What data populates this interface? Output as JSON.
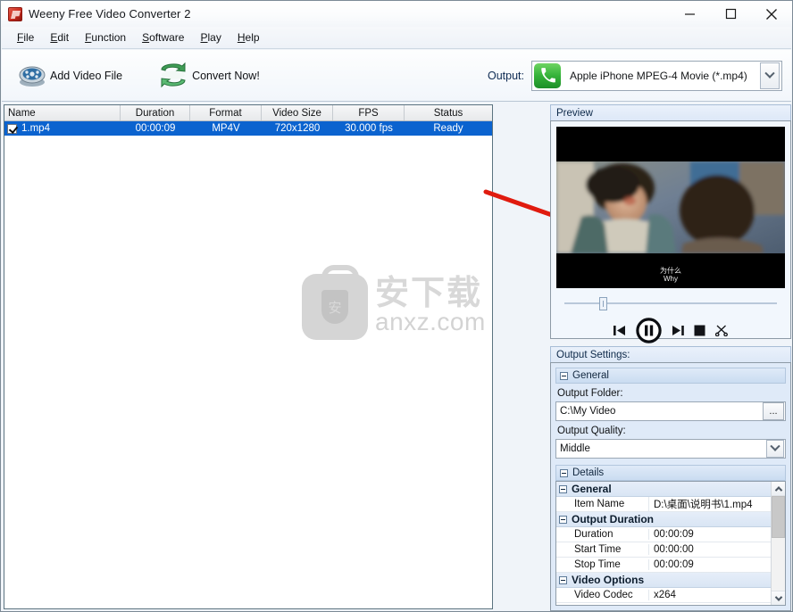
{
  "window": {
    "title": "Weeny Free Video Converter 2",
    "app_icon": "app-icon",
    "minimize": "–",
    "maximize": "□",
    "close": "✕"
  },
  "menubar": {
    "items": [
      {
        "label": "File",
        "accel": "F",
        "rest": "ile"
      },
      {
        "label": "Edit",
        "accel": "E",
        "rest": "dit"
      },
      {
        "label": "Function",
        "accel": "F",
        "rest": "unction"
      },
      {
        "label": "Software",
        "accel": "S",
        "rest": "oftware"
      },
      {
        "label": "Play",
        "accel": "P",
        "rest": "lay"
      },
      {
        "label": "Help",
        "accel": "H",
        "rest": "elp"
      }
    ]
  },
  "toolbar": {
    "add_video_label": "Add Video File",
    "convert_label": "Convert Now!",
    "output_label": "Output:",
    "output_value": "Apple iPhone MPEG-4 Movie (*.mp4)"
  },
  "filelist": {
    "columns": [
      "Name",
      "Duration",
      "Format",
      "Video Size",
      "FPS",
      "Status"
    ],
    "rows": [
      {
        "checked": true,
        "name": "1.mp4",
        "duration": "00:00:09",
        "format": "MP4V",
        "video_size": "720x1280",
        "fps": "30.000 fps",
        "status": "Ready"
      }
    ]
  },
  "watermark": {
    "cn": "安下载",
    "en": "anxz.com",
    "badge_glyph": "安"
  },
  "preview": {
    "title": "Preview",
    "subtitle_cn": "为什么",
    "subtitle_en": "Why",
    "controls": [
      {
        "name": "previous-button",
        "glyph": "previous-icon"
      },
      {
        "name": "pause-button",
        "glyph": "pause-icon"
      },
      {
        "name": "next-button",
        "glyph": "next-icon"
      },
      {
        "name": "stop-button",
        "glyph": "stop-icon"
      },
      {
        "name": "cut-button",
        "glyph": "scissors-icon"
      }
    ]
  },
  "output_settings": {
    "title": "Output Settings:",
    "general_label": "General",
    "output_folder_label": "Output Folder:",
    "output_folder_value": "C:\\My Video",
    "browse_label": "...",
    "output_quality_label": "Output Quality:",
    "output_quality_value": "Middle",
    "details_label": "Details"
  },
  "details": {
    "rows": [
      {
        "type": "cat",
        "name": "General"
      },
      {
        "type": "item",
        "name": "Item Name",
        "value": "D:\\桌面\\说明书\\1.mp4"
      },
      {
        "type": "cat",
        "name": "Output Duration"
      },
      {
        "type": "item",
        "name": "Duration",
        "value": "00:00:09"
      },
      {
        "type": "item",
        "name": "Start Time",
        "value": "00:00:00"
      },
      {
        "type": "item",
        "name": "Stop Time",
        "value": "00:00:09"
      },
      {
        "type": "cat",
        "name": "Video Options"
      },
      {
        "type": "item",
        "name": "Video Codec",
        "value": "x264"
      }
    ]
  },
  "colors": {
    "selection_blue": "#0b63cf",
    "panel_blue": "#dfeaf8",
    "accent_green": "#36b33a",
    "annotation_red": "#e01b0f"
  }
}
